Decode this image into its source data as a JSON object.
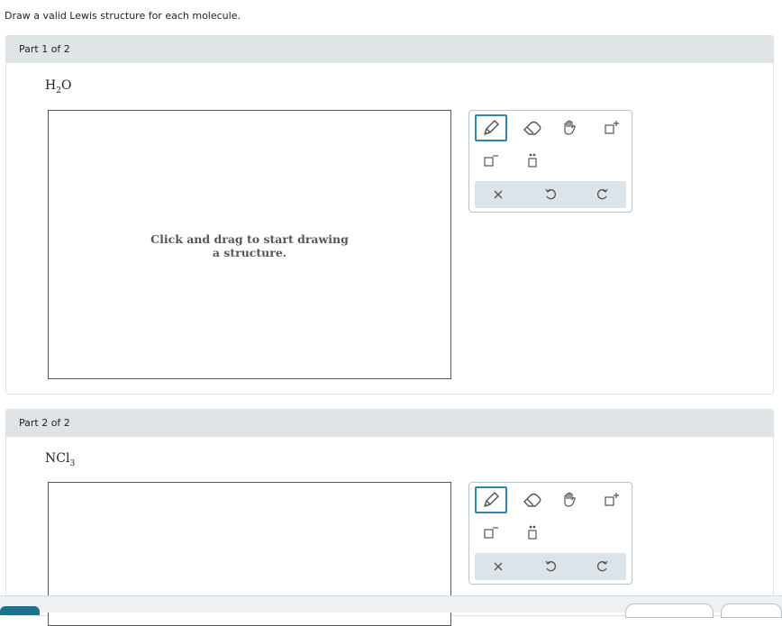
{
  "instructions": "Draw a valid Lewis structure for each molecule.",
  "parts": [
    {
      "header": "Part 1 of 2",
      "formula": {
        "base1": "H",
        "sub1": "2",
        "base2": "O"
      },
      "canvas_hint": "Click and drag to start drawing a structure."
    },
    {
      "header": "Part 2 of 2",
      "formula": {
        "base1": "NCl",
        "sub1": "3",
        "base2": ""
      }
    }
  ],
  "toolbox": {
    "tools": [
      "pencil-icon",
      "eraser-icon",
      "hand-icon",
      "positive-charge-icon",
      "negative-charge-icon",
      "lone-pair-icon"
    ],
    "actions": [
      "clear-icon",
      "undo-icon",
      "redo-icon"
    ],
    "selected_tool": "pencil-icon",
    "accent_color": "#2a86b8"
  }
}
